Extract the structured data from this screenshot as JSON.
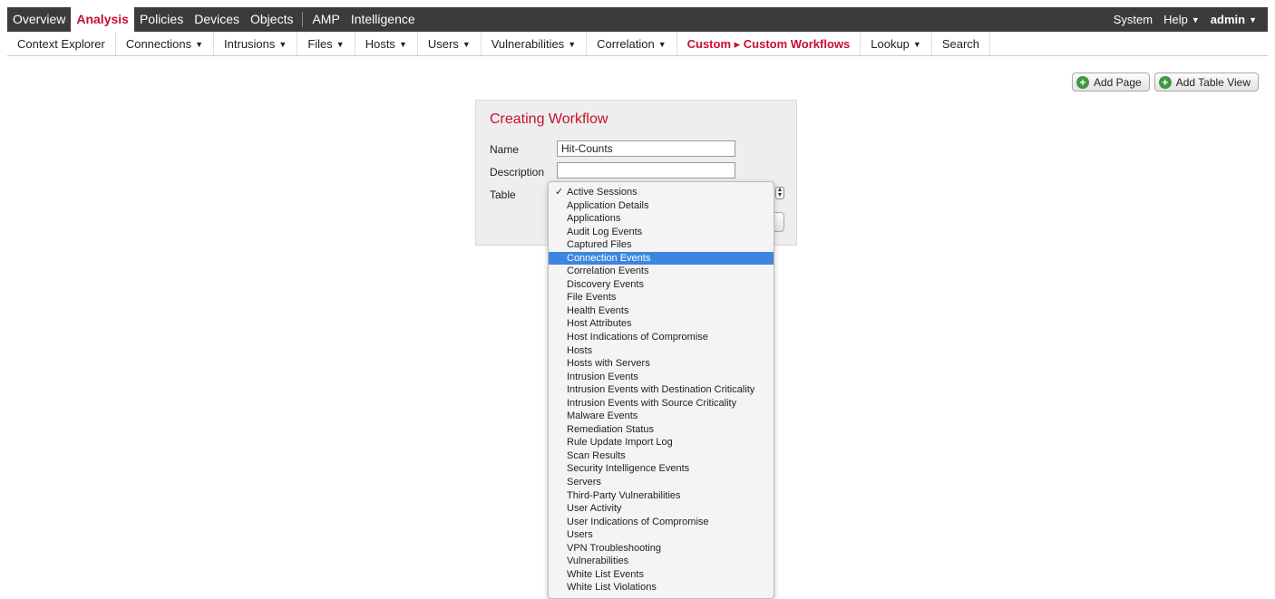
{
  "topnav": {
    "items": [
      "Overview",
      "Analysis",
      "Policies",
      "Devices",
      "Objects"
    ],
    "active": "Analysis",
    "items2": [
      "AMP",
      "Intelligence"
    ],
    "right": {
      "system": "System",
      "help": "Help",
      "user": "admin"
    }
  },
  "subnav": {
    "items": [
      "Context Explorer",
      "Connections",
      "Intrusions",
      "Files",
      "Hosts",
      "Users",
      "Vulnerabilities",
      "Correlation",
      "Custom ▸ Custom Workflows",
      "Lookup",
      "Search"
    ]
  },
  "buttons": {
    "add_page": "Add Page",
    "add_table_view": "Add Table View"
  },
  "form": {
    "title": "Creating Workflow",
    "name_label": "Name",
    "name_value": "Hit-Counts",
    "description_label": "Description",
    "description_value": "",
    "table_label": "Table"
  },
  "dropdown": {
    "selected": "Active Sessions",
    "highlighted": "Connection Events",
    "options": [
      "Active Sessions",
      "Application Details",
      "Applications",
      "Audit Log Events",
      "Captured Files",
      "Connection Events",
      "Correlation Events",
      "Discovery Events",
      "File Events",
      "Health Events",
      "Host Attributes",
      "Host Indications of Compromise",
      "Hosts",
      "Hosts with Servers",
      "Intrusion Events",
      "Intrusion Events with Destination Criticality",
      "Intrusion Events with Source Criticality",
      "Malware Events",
      "Remediation Status",
      "Rule Update Import Log",
      "Scan Results",
      "Security Intelligence Events",
      "Servers",
      "Third-Party Vulnerabilities",
      "User Activity",
      "User Indications of Compromise",
      "Users",
      "VPN Troubleshooting",
      "Vulnerabilities",
      "White List Events",
      "White List Violations"
    ]
  },
  "colors": {
    "accent": "#c8102e",
    "nav_bg": "#3b3b3b",
    "highlight": "#3d85e0",
    "plus_icon": "#3f9a3f"
  }
}
